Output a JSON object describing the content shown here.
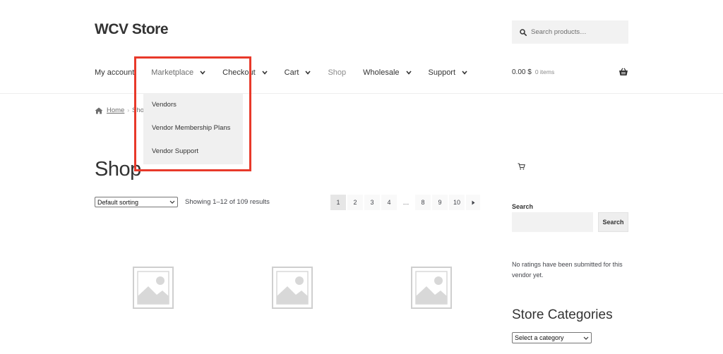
{
  "header": {
    "site_title": "WCV Store",
    "search_placeholder": "Search products…"
  },
  "nav": {
    "items": [
      {
        "label": "My account",
        "has_dropdown": false
      },
      {
        "label": "Marketplace",
        "has_dropdown": true
      },
      {
        "label": "Checkout",
        "has_dropdown": true
      },
      {
        "label": "Cart",
        "has_dropdown": true
      },
      {
        "label": "Shop",
        "has_dropdown": false
      },
      {
        "label": "Wholesale",
        "has_dropdown": true
      },
      {
        "label": "Support",
        "has_dropdown": true
      }
    ],
    "marketplace_menu": [
      "Vendors",
      "Vendor Membership Plans",
      "Vendor Support"
    ]
  },
  "cart": {
    "total": "0.00 $",
    "items": "0 items"
  },
  "breadcrumb": {
    "home": "Home",
    "current": "Sho"
  },
  "main": {
    "title": "Shop",
    "sort_selected": "Default sorting",
    "result_count": "Showing 1–12 of 109 results",
    "pages": [
      "1",
      "2",
      "3",
      "4",
      "…",
      "8",
      "9",
      "10"
    ],
    "current_page": "1"
  },
  "sidebar": {
    "search_label": "Search",
    "search_button": "Search",
    "ratings_note": "No ratings have been submitted for this vendor yet.",
    "categories_title": "Store Categories",
    "category_selected": "Select a category"
  },
  "colors": {
    "highlight_box": "#e8392a",
    "dropdown_bg": "#f0f0f0",
    "text": "#333333"
  }
}
